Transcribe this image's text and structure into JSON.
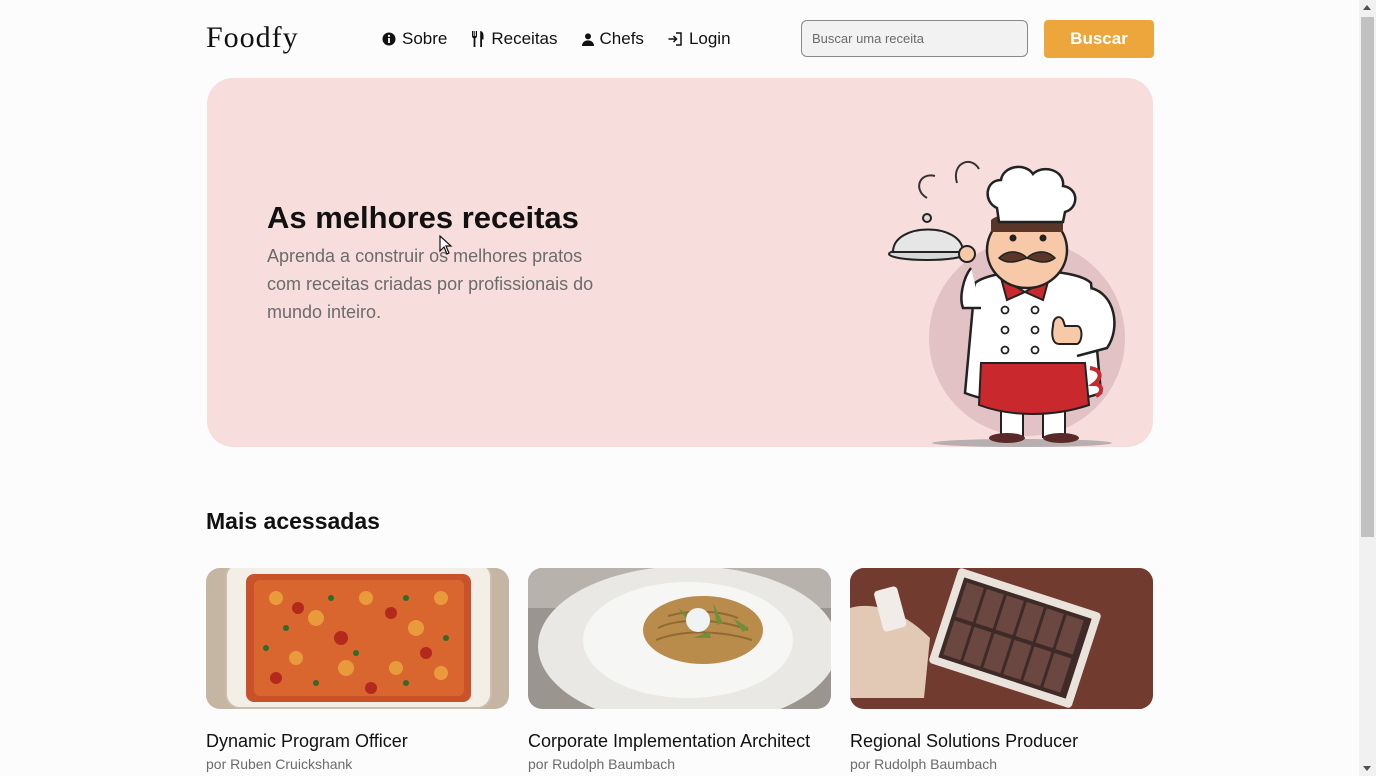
{
  "header": {
    "logo": "Foodfy",
    "nav": [
      {
        "label": "Sobre",
        "icon": "info-icon"
      },
      {
        "label": "Receitas",
        "icon": "fork-knife-icon"
      },
      {
        "label": "Chefs",
        "icon": "person-icon"
      },
      {
        "label": "Login",
        "icon": "login-icon"
      }
    ],
    "search_placeholder": "Buscar uma receita",
    "search_button": "Buscar"
  },
  "hero": {
    "title": "As melhores receitas",
    "description": "Aprenda a construir os melhores pratos com receitas criadas por profissionais do mundo inteiro.",
    "image": "chef-illustration"
  },
  "section": {
    "title": "Mais acessadas"
  },
  "recipes": [
    {
      "name": "Dynamic Program Officer",
      "author": "por Ruben Cruickshank",
      "image": "pasta-bake"
    },
    {
      "name": "Corporate Implementation Architect",
      "author": "por Rudolph Baumbach",
      "image": "spaghetti-plate"
    },
    {
      "name": "Regional Solutions Producer",
      "author": "por Rudolph Baumbach",
      "image": "chocolate-box"
    }
  ],
  "colors": {
    "accent": "#eca63b",
    "hero_bg": "#f7dedd",
    "muted_text": "#6b6b6b"
  }
}
